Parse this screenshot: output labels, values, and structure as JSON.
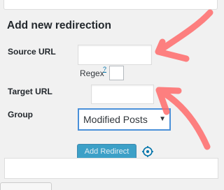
{
  "form": {
    "heading": "Add new redirection",
    "source_label": "Source URL",
    "source_value": "",
    "regex_label": "Regex",
    "regex_help": "?",
    "regex_checked": false,
    "target_label": "Target URL",
    "target_value": "",
    "group_label": "Group",
    "group_selected": "Modified Posts",
    "add_button": "Add Redirect"
  },
  "icons": {
    "settings": "gear-icon",
    "select_arrow": "chevron-down-icon"
  },
  "colors": {
    "button": "#0085ba",
    "select_focus": "#4a90d9",
    "annotation": "#ff6b6b"
  }
}
